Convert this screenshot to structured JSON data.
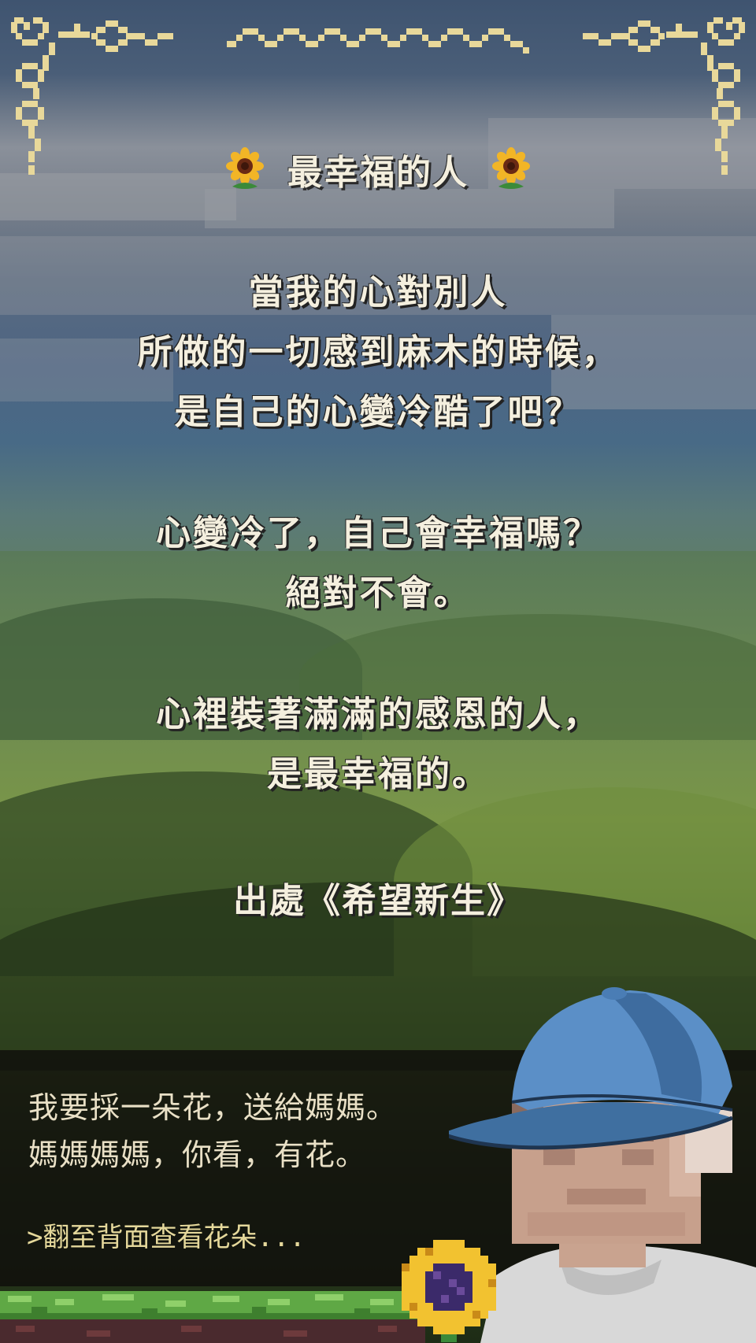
{
  "title": "最幸福的人",
  "poem": {
    "stanzas": [
      [
        "當我的心對別人",
        "所做的一切感到麻木的時候，",
        "是自己的心變冷酷了吧？"
      ],
      [
        "心變冷了，自己會幸福嗎？",
        "絕對不會。"
      ],
      [
        "心裡裝著滿滿的感恩的人，",
        "是最幸福的。"
      ]
    ]
  },
  "source": "出處《希望新生》",
  "dialog": {
    "line1": "我要採一朵花，送給媽媽。",
    "line2": "媽媽媽媽，你看，有花。",
    "prompt": ">翻至背面查看花朵..."
  },
  "icons": {
    "title_left": "sunflower-icon",
    "title_right": "sunflower-icon",
    "bottom": "pixel-sunflower-icon"
  },
  "colors": {
    "text": "#f4efde",
    "border_ornament": "#e8d89a",
    "dialog_text": "#e9e0c6",
    "prompt_text": "#e5d89b",
    "cap": "#5b8fc7"
  }
}
